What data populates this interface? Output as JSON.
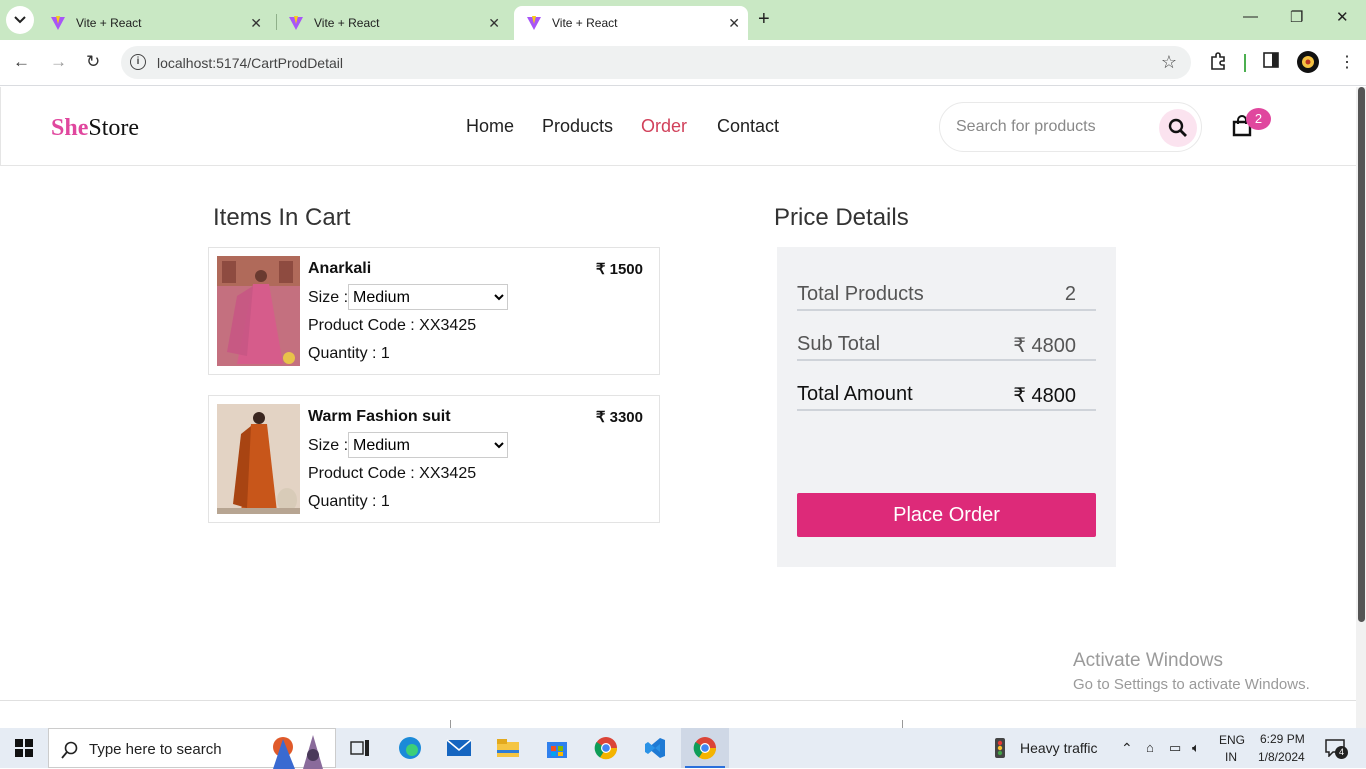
{
  "browser": {
    "tabs": [
      {
        "title": "Vite + React"
      },
      {
        "title": "Vite + React"
      },
      {
        "title": "Vite + React"
      }
    ],
    "url": "localhost:5174/CartProdDetail"
  },
  "header": {
    "logo_she": "She",
    "logo_store": "Store",
    "nav": [
      "Home",
      "Products",
      "Order",
      "Contact"
    ],
    "active_nav": "Order",
    "search_placeholder": "Search for products",
    "cart_count": "2"
  },
  "cart": {
    "title": "Items In Cart",
    "items": [
      {
        "name": "Anarkali",
        "price": "₹ 1500",
        "size_label": "Size :",
        "size": "Medium",
        "code": "Product Code : XX3425",
        "quantity": "Quantity : 1"
      },
      {
        "name": "Warm Fashion suit",
        "price": "₹ 3300",
        "size_label": "Size :",
        "size": "Medium",
        "code": "Product Code : XX3425",
        "quantity": "Quantity : 1"
      }
    ]
  },
  "price": {
    "title": "Price Details",
    "total_products_label": "Total Products",
    "total_products": "2",
    "sub_total_label": "Sub Total",
    "sub_total": "₹ 4800",
    "total_amount_label": "Total Amount",
    "total_amount": "₹ 4800",
    "place_order": "Place Order"
  },
  "watermark": {
    "line1": "Activate Windows",
    "line2": "Go to Settings to activate Windows."
  },
  "taskbar": {
    "search": "Type here to search",
    "weather": "Heavy traffic",
    "lang1": "ENG",
    "lang2": "IN",
    "time": "6:29 PM",
    "date": "1/8/2024",
    "notifications": "4"
  },
  "colors": {
    "brand": "#e0479e",
    "place_order": "#dd2a79",
    "active_nav": "#d1405a"
  }
}
